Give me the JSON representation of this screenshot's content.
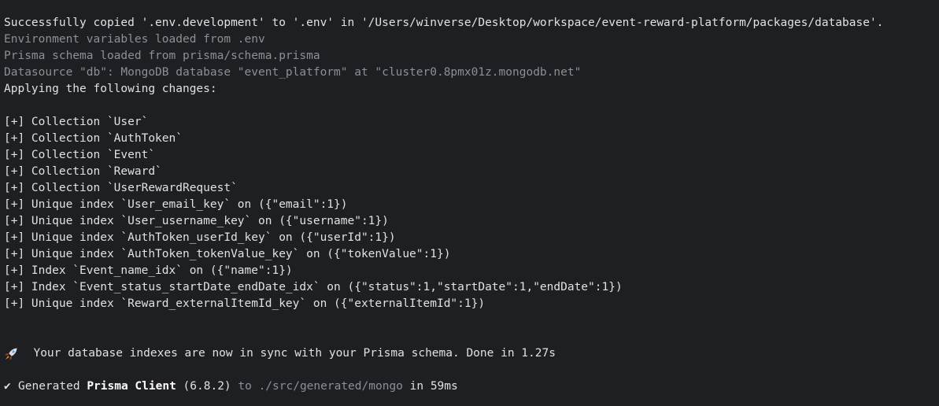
{
  "header_lines": [
    "Successfully copied '.env.development' to '.env' in '/Users/winverse/Desktop/workspace/event-reward-platform/packages/database'.",
    "Environment variables loaded from .env",
    "Prisma schema loaded from prisma/schema.prisma",
    "Datasource \"db\": MongoDB database \"event_platform\" at \"cluster0.8pmx01z.mongodb.net\"",
    "Applying the following changes:"
  ],
  "changes": [
    "[+] Collection `User`",
    "[+] Collection `AuthToken`",
    "[+] Collection `Event`",
    "[+] Collection `Reward`",
    "[+] Collection `UserRewardRequest`",
    "[+] Unique index `User_email_key` on ({\"email\":1})",
    "[+] Unique index `User_username_key` on ({\"username\":1})",
    "[+] Unique index `AuthToken_userId_key` on ({\"userId\":1})",
    "[+] Unique index `AuthToken_tokenValue_key` on ({\"tokenValue\":1})",
    "[+] Index `Event_name_idx` on ({\"name\":1})",
    "[+] Index `Event_status_startDate_endDate_idx` on ({\"status\":1,\"startDate\":1,\"endDate\":1})",
    "[+] Unique index `Reward_externalItemId_key` on ({\"externalItemId\":1})"
  ],
  "sync_message": {
    "icon": "rocket-icon",
    "text": "Your database indexes are now in sync with your Prisma schema. Done in 1.27s"
  },
  "generated": {
    "icon": "check-icon",
    "check_glyph": "✔",
    "prefix": "Generated ",
    "client_name": "Prisma Client",
    "version": " (6.8.2)",
    "to_text": " to ./src/generated/mongo",
    "duration": " in 59ms"
  },
  "colors": {
    "background": "#1e1f22",
    "text": "#dfe1e5",
    "dim": "#8c8f94"
  }
}
